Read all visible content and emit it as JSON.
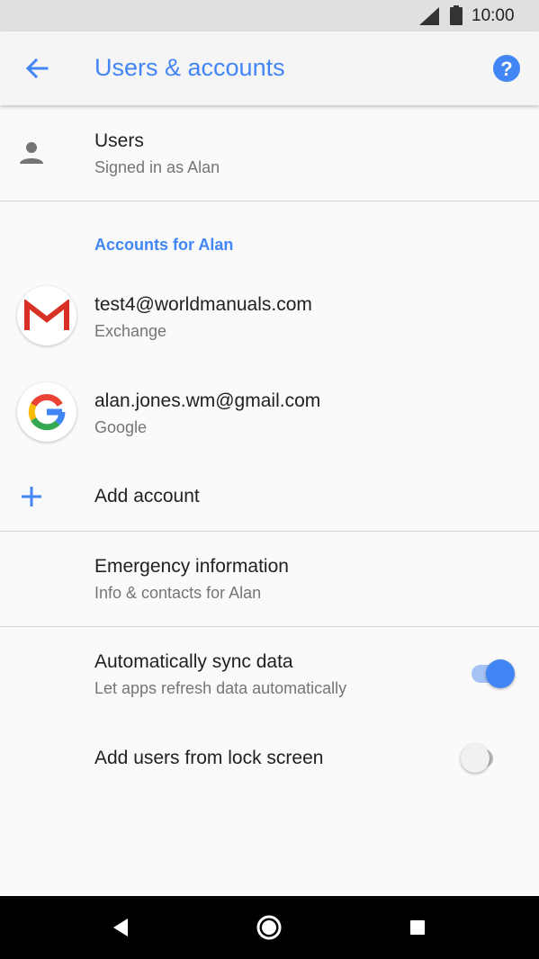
{
  "status_bar": {
    "time": "10:00",
    "icons": [
      "signal-icon",
      "battery-icon"
    ]
  },
  "app_bar": {
    "title": "Users & accounts",
    "back_icon": "arrow-back-icon",
    "help_icon": "help-icon"
  },
  "users": {
    "icon": "person-icon",
    "title": "Users",
    "subtitle": "Signed in as Alan"
  },
  "accounts_section": {
    "header": "Accounts for Alan",
    "items": [
      {
        "title": "test4@worldmanuals.com",
        "subtitle": "Exchange",
        "icon": "gmail-icon"
      },
      {
        "title": "alan.jones.wm@gmail.com",
        "subtitle": "Google",
        "icon": "google-icon"
      }
    ],
    "add_account": {
      "label": "Add account",
      "icon": "plus-icon"
    }
  },
  "emergency": {
    "title": "Emergency information",
    "subtitle": "Info & contacts for Alan"
  },
  "auto_sync": {
    "title": "Automatically sync data",
    "subtitle": "Let apps refresh data automatically",
    "enabled": true
  },
  "lock_screen_users": {
    "title": "Add users from lock screen",
    "enabled": false
  },
  "nav_bar": {
    "buttons": [
      "back-triangle-icon",
      "home-circle-icon",
      "recents-square-icon"
    ]
  },
  "colors": {
    "accent": "#4285f4",
    "switch_on_thumb": "#4285f4",
    "switch_on_track": "#a4c2f4",
    "switch_off_thumb": "#f1f1f1",
    "switch_off_track": "#b9b9b9"
  }
}
